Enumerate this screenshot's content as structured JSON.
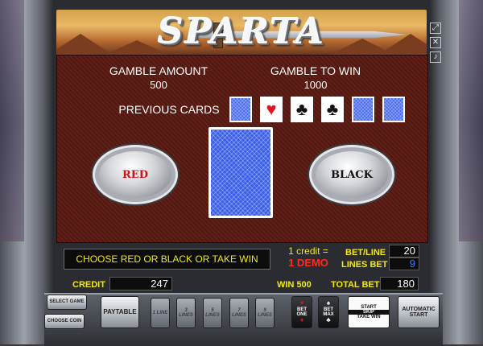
{
  "header": {
    "logo_text": "SPARTA",
    "right_icons": [
      "fullscreen-icon",
      "close-icon",
      "sound-icon"
    ]
  },
  "gamble": {
    "amount_label": "GAMBLE AMOUNT",
    "amount_value": "500",
    "to_win_label": "GAMBLE TO WIN",
    "to_win_value": "1000",
    "previous_cards_label": "PREVIOUS CARDS",
    "previous_cards": [
      {
        "type": "back"
      },
      {
        "type": "face",
        "suit": "hearts",
        "symbol": "♥",
        "color": "#e0141c"
      },
      {
        "type": "face",
        "suit": "clubs",
        "symbol": "♣",
        "color": "#111111"
      },
      {
        "type": "face",
        "suit": "clubs",
        "symbol": "♣",
        "color": "#111111"
      },
      {
        "type": "back"
      },
      {
        "type": "back"
      }
    ],
    "red_label": "RED",
    "black_label": "BLACK"
  },
  "status": {
    "message": "CHOOSE RED OR BLACK OR TAKE WIN",
    "credit_rate": "1 credit =",
    "credit_demo": "1 DEMO",
    "bet_line_label": "BET/LINE",
    "bet_line_value": "20",
    "lines_bet_label": "LINES BET",
    "lines_bet_value": "9",
    "credit_label": "CREDIT",
    "credit_value": "247",
    "win_label": "WIN 500",
    "total_bet_label": "TOTAL BET",
    "total_bet_value": "180"
  },
  "buttons": {
    "select_game": "SELECT GAME",
    "choose_coin": "CHOOSE COIN",
    "paytable": "PAYTABLE",
    "line1": "1 LINE",
    "line3": "3 LINES",
    "line5": "5 LINES",
    "line7": "7 LINES",
    "line9": "9 LINES",
    "bet_one": "BET ONE",
    "bet_max": "BET MAX",
    "start": "START",
    "skip": "SKIP",
    "take_win": "TAKE WIN",
    "autostart": "AUTOMATIC START"
  },
  "colors": {
    "board": "#5a1a12",
    "card_back": "#3b5fe8",
    "message_text": "#f2e90a",
    "demo_text": "#ff2a1a"
  }
}
